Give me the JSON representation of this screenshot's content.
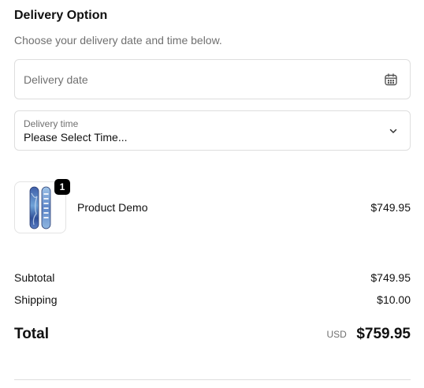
{
  "delivery": {
    "title": "Delivery Option",
    "subtitle": "Choose your delivery date and time below.",
    "date_placeholder": "Delivery date",
    "time_label": "Delivery time",
    "time_value": "Please Select Time..."
  },
  "product": {
    "name": "Product Demo",
    "price": "$749.95",
    "quantity": "1",
    "thumbnail_icon": "snowboard-product-image"
  },
  "summary": {
    "subtotal_label": "Subtotal",
    "subtotal_value": "$749.95",
    "shipping_label": "Shipping",
    "shipping_value": "$10.00",
    "total_label": "Total",
    "total_currency": "USD",
    "total_value": "$759.95"
  },
  "icons": {
    "date": "calendar-icon",
    "time": "chevron-down-icon"
  },
  "colors": {
    "text": "#111111",
    "muted": "#707070",
    "border": "#dedede",
    "badge": "#000000"
  }
}
